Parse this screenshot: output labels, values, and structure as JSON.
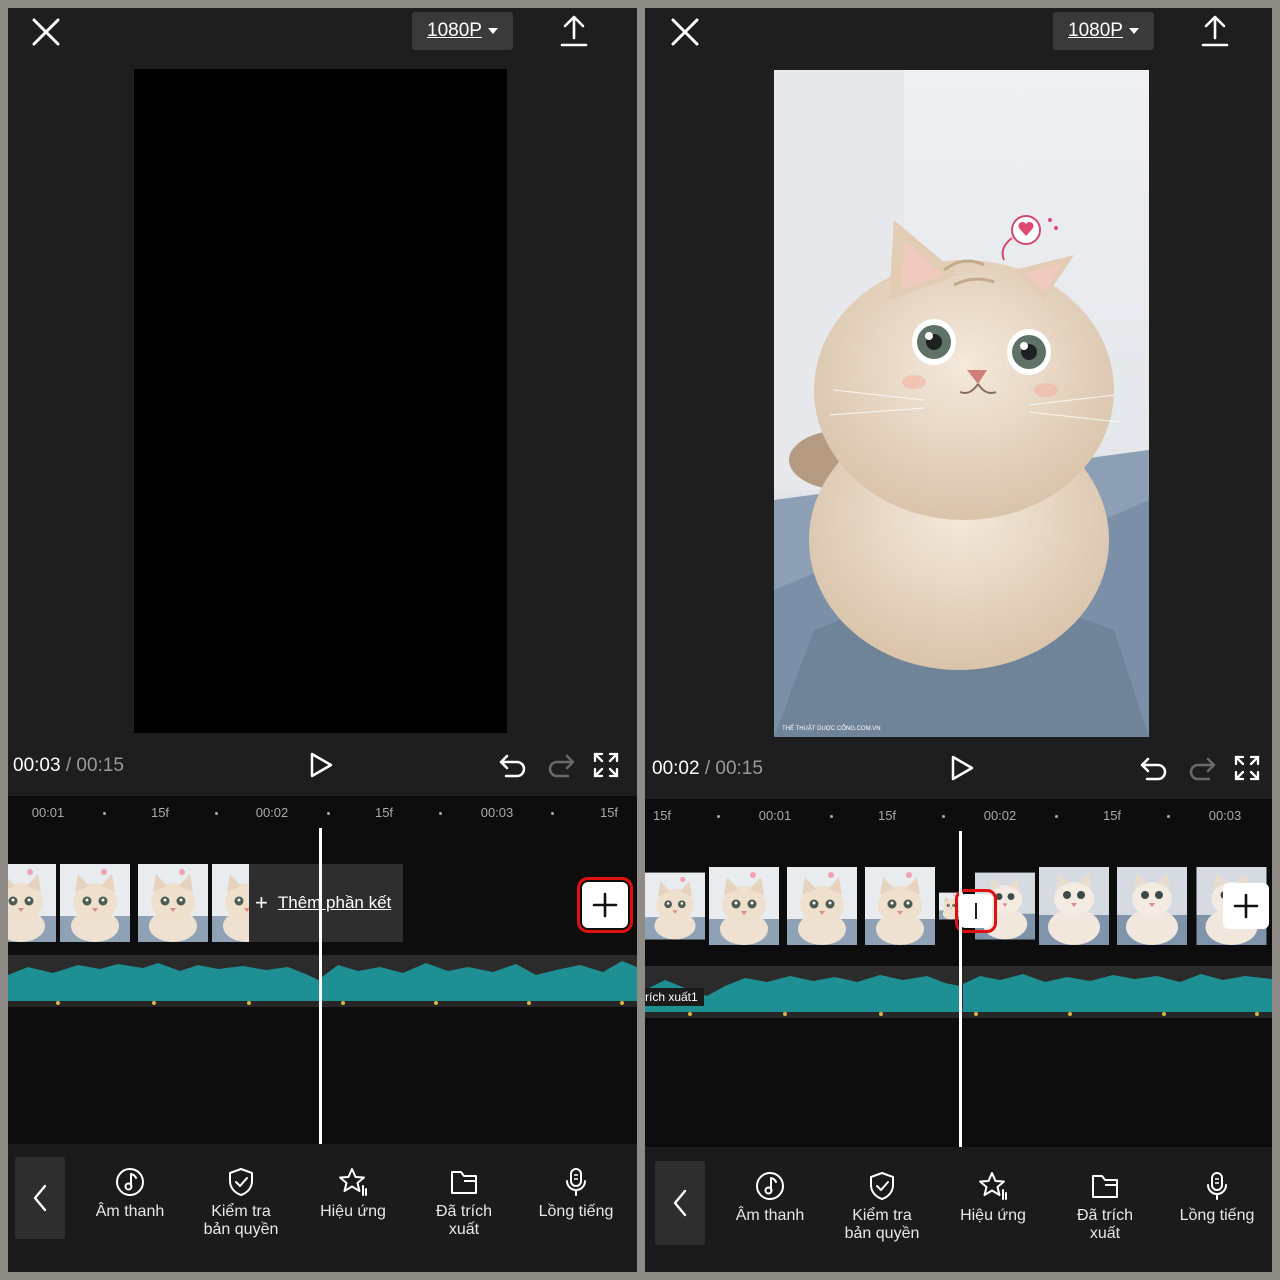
{
  "left": {
    "resolution": "1080P",
    "time_current": "00:03",
    "time_sep": "/",
    "time_total": "00:15",
    "ruler": [
      "00:01",
      "15f",
      "00:02",
      "15f",
      "00:03",
      "15f"
    ],
    "add_ending_label": "Thêm phần kết"
  },
  "right": {
    "resolution": "1080P",
    "time_current": "00:02",
    "time_sep": "/",
    "time_total": "00:15",
    "ruler": [
      "15f",
      "00:01",
      "15f",
      "00:02",
      "15f",
      "00:03"
    ],
    "audio_label": "rích xuất1",
    "watermark": "THẾ THUẬT DUỢC CỔNG.COM.VN"
  },
  "toolbar": [
    {
      "line1": "Âm thanh",
      "line2": "",
      "icon": "music-note-icon"
    },
    {
      "line1": "Kiểm tra",
      "line2": "bản quyền",
      "icon": "shield-check-icon"
    },
    {
      "line1": "Hiệu ứng",
      "line2": "",
      "icon": "star-effect-icon"
    },
    {
      "line1": "Đã trích",
      "line2": "xuất",
      "icon": "folder-icon"
    },
    {
      "line1": "Lồng tiếng",
      "line2": "",
      "icon": "microphone-icon"
    }
  ],
  "colors": {
    "background": "#1e1e1e",
    "timeline": "#0d0d0d",
    "audio_wave": "#1e8f92",
    "highlight": "#e01010"
  }
}
